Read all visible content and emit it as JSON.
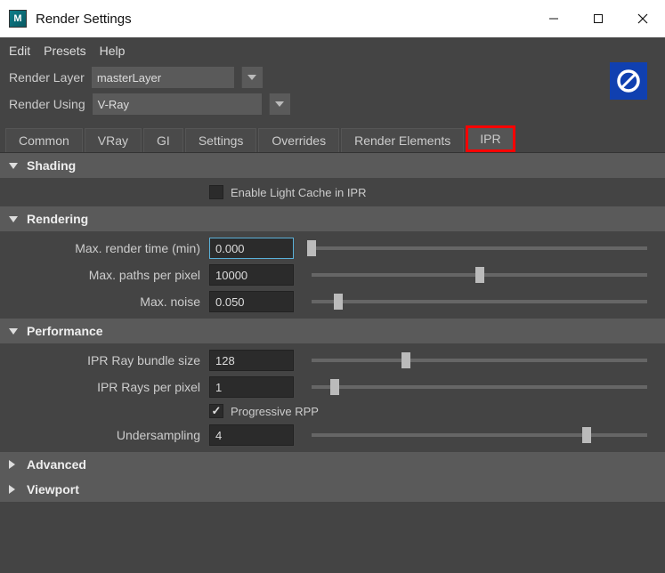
{
  "window": {
    "title": "Render Settings"
  },
  "menu": {
    "edit": "Edit",
    "presets": "Presets",
    "help": "Help"
  },
  "renderLayer": {
    "label": "Render Layer",
    "value": "masterLayer"
  },
  "renderUsing": {
    "label": "Render Using",
    "value": "V-Ray"
  },
  "tabs": {
    "common": "Common",
    "vray": "VRay",
    "gi": "GI",
    "settings": "Settings",
    "overrides": "Overrides",
    "renderElements": "Render Elements",
    "ipr": "IPR"
  },
  "sections": {
    "shading": {
      "title": "Shading",
      "enableLightCache": "Enable Light Cache in IPR"
    },
    "rendering": {
      "title": "Rendering",
      "maxRenderTime": {
        "label": "Max. render time (min)",
        "value": "0.000"
      },
      "maxPathsPerPixel": {
        "label": "Max. paths per pixel",
        "value": "10000"
      },
      "maxNoise": {
        "label": "Max. noise",
        "value": "0.050"
      }
    },
    "performance": {
      "title": "Performance",
      "iprRayBundleSize": {
        "label": "IPR Ray bundle size",
        "value": "128"
      },
      "iprRaysPerPixel": {
        "label": "IPR Rays per pixel",
        "value": "1"
      },
      "progressiveRPP": {
        "label": "Progressive RPP"
      },
      "undersampling": {
        "label": "Undersampling",
        "value": "4"
      }
    },
    "advanced": {
      "title": "Advanced"
    },
    "viewport": {
      "title": "Viewport"
    }
  }
}
